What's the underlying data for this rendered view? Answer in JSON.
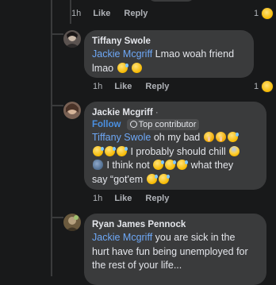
{
  "top_meta": {
    "time": "1h",
    "like": "Like",
    "reply": "Reply",
    "reaction_count": "1"
  },
  "comments": [
    {
      "author": "Tiffany Swole",
      "mention": "Jackie Mcgriff",
      "text_after_mention": " Lmao woah friend",
      "line2": "lmao",
      "time": "1h",
      "like": "Like",
      "reply": "Reply",
      "reaction_count": "1"
    },
    {
      "author": "Jackie Mcgriff",
      "dot": "·",
      "follow": "Follow",
      "badge": "Top contributor",
      "mention": "Tiffany Swole",
      "text_after_mention": " oh my bad",
      "line2": " I probably should chill",
      "line3": " I think not",
      "line3b": " what they",
      "line4": "say “got'em",
      "time": "1h",
      "like": "Like",
      "reply": "Reply"
    },
    {
      "author": "Ryan James Pennock",
      "mention": "Jackie Mcgriff",
      "text_after_mention": " you are sick in the",
      "line2": "hurt have fun being unemployed for",
      "line3": "the rest of your life..."
    }
  ],
  "colors": {
    "bubble": "#3a3b3c",
    "background": "#18191a",
    "mention": "#6ea8f7",
    "follow": "#4a90e2"
  },
  "icons": [
    "avatar",
    "laugh-emoji-icon",
    "shush-emoji-icon",
    "fear-emoji-icon",
    "wind-emoji-icon",
    "medal-icon",
    "reaction-icon"
  ]
}
